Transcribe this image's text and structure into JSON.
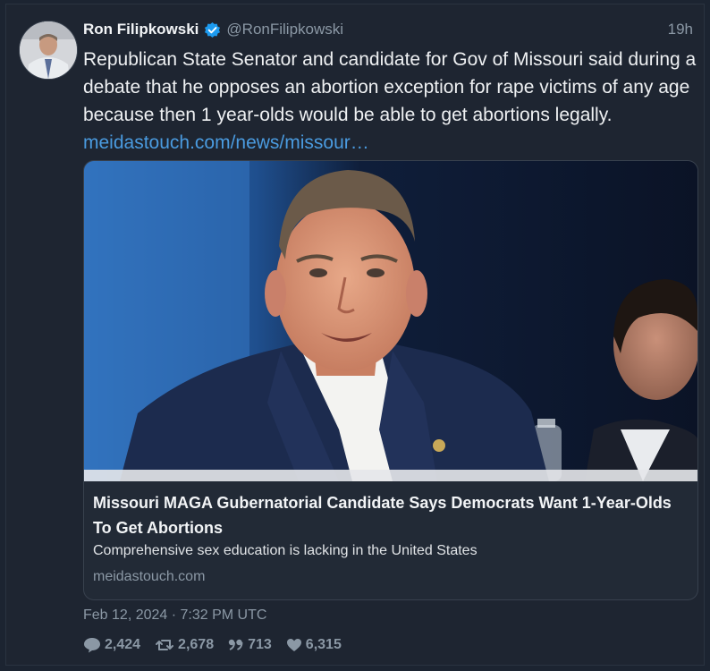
{
  "author": {
    "name": "Ron Filipkowski",
    "handle": "@RonFilipkowski",
    "verified_icon": "verified-badge-icon"
  },
  "time_ago": "19h",
  "text": "Republican State Senator and candidate for Gov of Missouri said during a debate that he opposes an abortion exception for rape victims of any age because then 1 year-olds would be able to get abortions legally. ",
  "link": "meidastouch.com/news/missour…",
  "card": {
    "title": "Missouri MAGA Gubernatorial Candidate Says Democrats Want 1-Year-Olds To Get Abortions",
    "description": "Comprehensive sex education is lacking in the United States",
    "domain": "meidastouch.com"
  },
  "timestamp": "Feb 12, 2024 · 7:32 PM UTC",
  "stats": {
    "replies": "2,424",
    "retweets": "2,678",
    "quotes": "713",
    "likes": "6,315"
  },
  "colors": {
    "background": "#1e2531",
    "link": "#4a9be0",
    "muted": "#8b98a5",
    "verified": "#1d9bf0"
  }
}
